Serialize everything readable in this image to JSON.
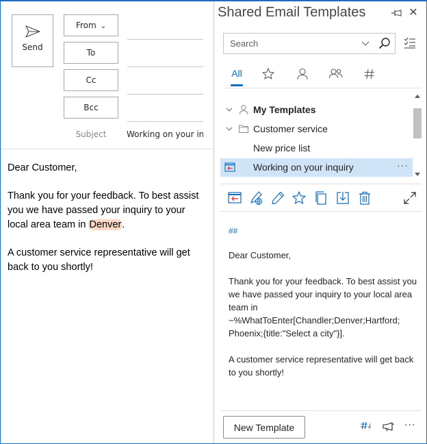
{
  "compose": {
    "send_label": "Send",
    "from_label": "From",
    "to_label": "To",
    "cc_label": "Cc",
    "bcc_label": "Bcc",
    "subject_label": "Subject",
    "subject_value": "Working on your inquiry",
    "body": {
      "greeting": "Dear Customer,",
      "para1_before": "Thank you for your feedback. To best assist you we have passed your inquiry to your local area team in ",
      "para1_highlight": "Denver",
      "para1_after": ".",
      "para2": "A customer service representative will get back to you shortly!"
    }
  },
  "pane": {
    "title": "Shared Email Templates",
    "search": {
      "placeholder": "Search",
      "value": ""
    },
    "tabs": [
      {
        "label": "All",
        "icon": "all",
        "active": true
      },
      {
        "label": "",
        "icon": "star-icon"
      },
      {
        "label": "",
        "icon": "person-icon"
      },
      {
        "label": "",
        "icon": "people-icon"
      },
      {
        "label": "",
        "icon": "hashtag-icon"
      }
    ],
    "tree": [
      {
        "label": "My Templates",
        "icon": "person-icon",
        "expanded": true,
        "bold": true
      },
      {
        "label": "Customer service",
        "icon": "folder-icon",
        "expanded": true
      },
      {
        "label": "New price list"
      },
      {
        "label": "Working on your inquiry",
        "selected": true,
        "icon": "insert-template-icon",
        "more": "···"
      }
    ],
    "toolbar": [
      "insert-icon",
      "edit-online-icon",
      "edit-icon",
      "favorite-icon",
      "copy-icon",
      "move-icon",
      "delete-icon",
      "expand-icon"
    ],
    "preview": {
      "hash": "##",
      "greeting": "Dear Customer,",
      "para1": "Thank you for your feedback. To best assist you we have passed your inquiry to your local area team in ~%WhatToEnter[Chandler;Denver;Hartford; Phoenix;{title:\"Select a city\"}].",
      "para2": "A customer service representative will get back to you shortly!"
    },
    "footer": {
      "new_template_label": "New Template",
      "more": "···"
    }
  },
  "colors": {
    "accent": "#0f6cbd",
    "selection": "#cfe4f6",
    "highlight": "#fbd9c7",
    "insert_red": "#e3263a"
  }
}
